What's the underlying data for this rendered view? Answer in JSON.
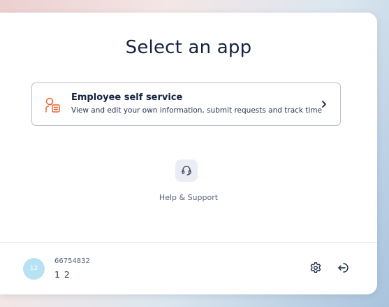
{
  "page": {
    "title": "Select an app"
  },
  "apps": [
    {
      "title": "Employee self service",
      "description": "View and edit your own information, submit requests and track time",
      "icon": "employee-self-service-icon",
      "accent": "#e8602c"
    }
  ],
  "help": {
    "label": "Help & Support",
    "icon": "headset-icon"
  },
  "user": {
    "initials": "12",
    "id": "66754832",
    "name": "1 2",
    "avatar_color": "#b6e2f4"
  },
  "footer_actions": {
    "settings_icon": "gear-icon",
    "logout_icon": "logout-icon"
  }
}
